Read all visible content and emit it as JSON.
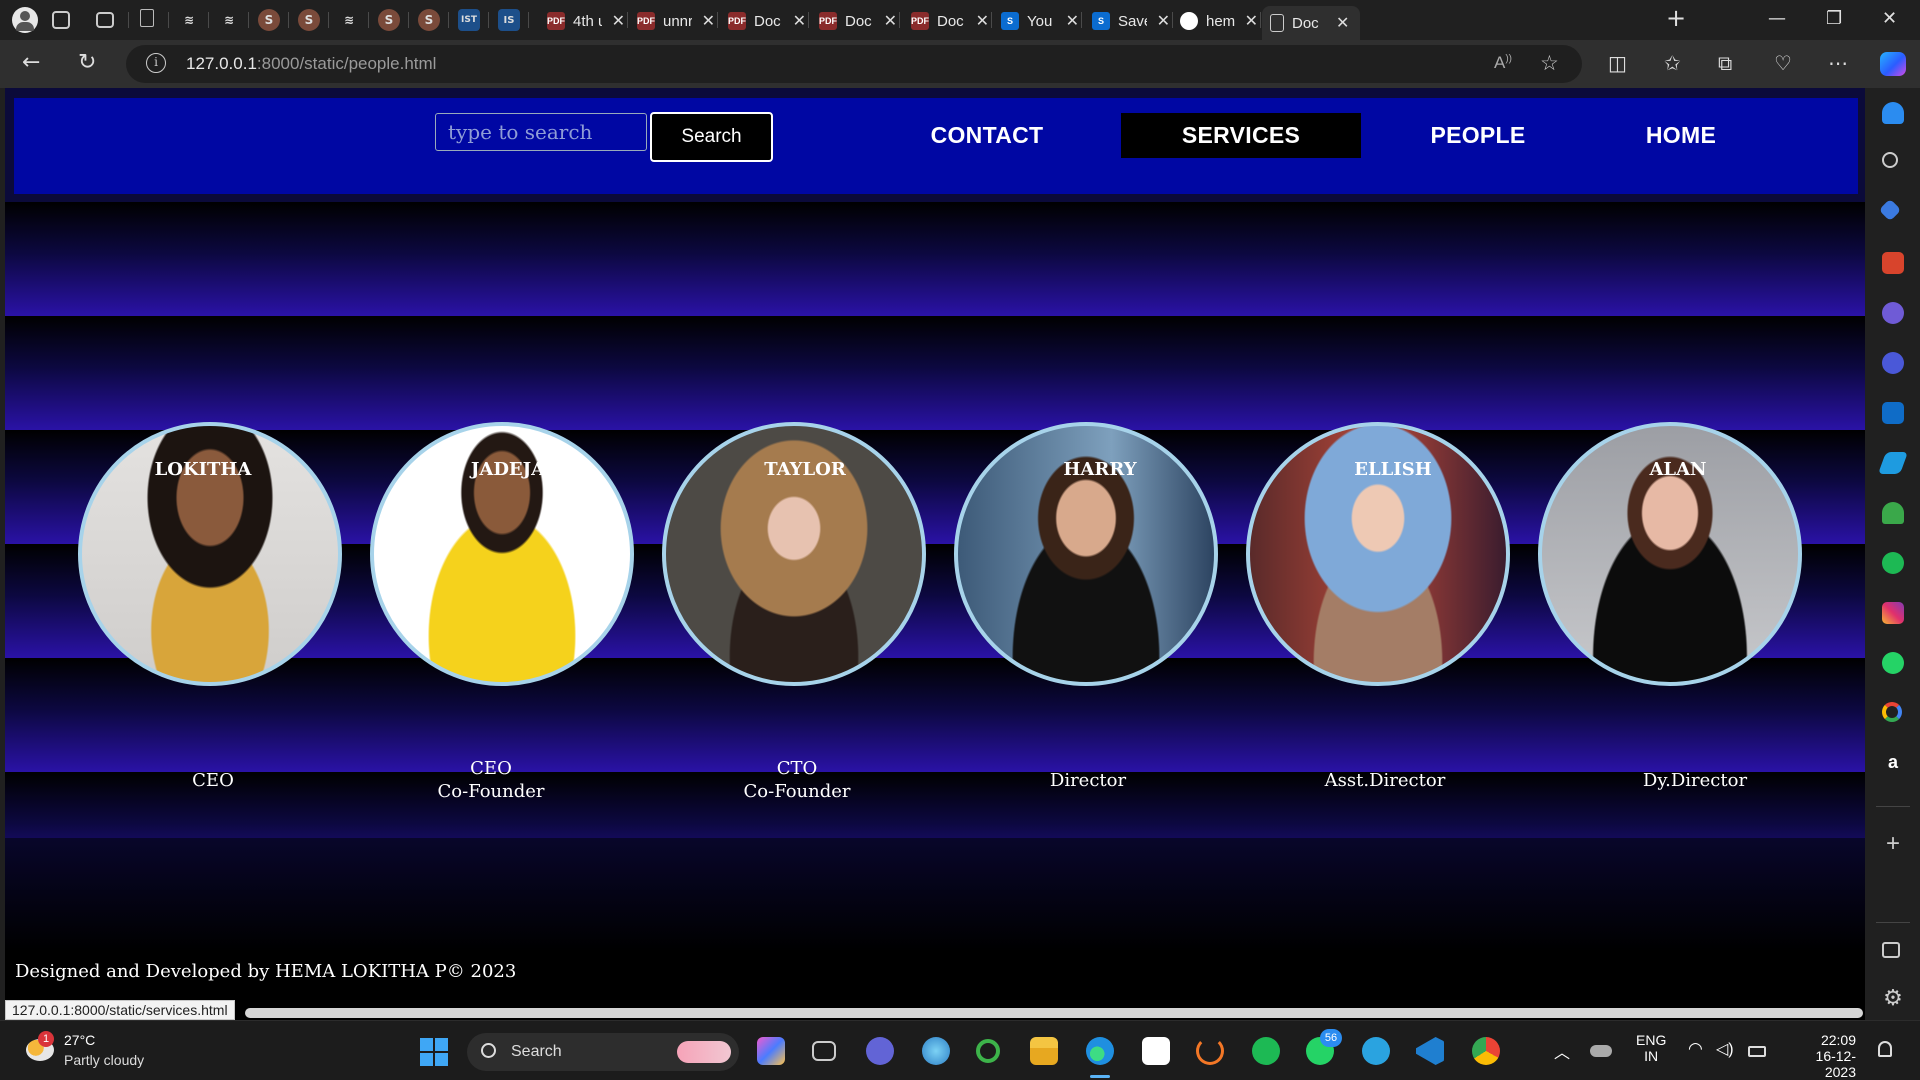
{
  "browser": {
    "tabs": [
      {
        "label": "4th u",
        "fav": "PDF",
        "color": "#8a2b2b"
      },
      {
        "label": "unnr",
        "fav": "PDF",
        "color": "#8a2b2b"
      },
      {
        "label": "Doc",
        "fav": "PDF",
        "color": "#8a2b2b"
      },
      {
        "label": "Doc",
        "fav": "PDF",
        "color": "#8a2b2b"
      },
      {
        "label": "Doc",
        "fav": "PDF",
        "color": "#8a2b2b"
      },
      {
        "label": "You",
        "fav": "S",
        "color": "#0b6cd0"
      },
      {
        "label": "Save",
        "fav": "S",
        "color": "#0b6cd0"
      },
      {
        "label": "hem",
        "fav": "gh",
        "color": "#202020"
      },
      {
        "label": "Doc",
        "fav": "doc",
        "color": "#2f2f2f"
      }
    ],
    "url_host": "127.0.0.1",
    "url_rest": ":8000/static/people.html",
    "status_url": "127.0.0.1:8000/static/services.html",
    "small_tab_icons": [
      "IST",
      "IS"
    ]
  },
  "page": {
    "search_placeholder": "type to search",
    "search_button": "Search",
    "nav": {
      "contact": "CONTACT",
      "services": "SERVICES",
      "people": "PEOPLE",
      "home": "HOME"
    },
    "people": [
      {
        "name": "LOKITHA",
        "role": "CEO",
        "role2": ""
      },
      {
        "name": "JADEJA",
        "role": "CEO",
        "role2": "Co-Founder"
      },
      {
        "name": "TAYLOR",
        "role": "CTO",
        "role2": "Co-Founder"
      },
      {
        "name": "HARRY",
        "role": "Director",
        "role2": ""
      },
      {
        "name": "ELLISH",
        "role": "Asst.Director",
        "role2": ""
      },
      {
        "name": "ALAN",
        "role": "Dy.Director",
        "role2": ""
      }
    ],
    "footer": "Designed and Developed by HEMA LOKITHA P© 2023"
  },
  "taskbar": {
    "weather_temp": "27°C",
    "weather_desc": "Partly cloudy",
    "weather_badge": "1",
    "search_label": "Search",
    "whatsapp_badge": "56",
    "lang": "ENG",
    "region": "IN",
    "time": "22:09",
    "date": "16-12-2023"
  },
  "colors": {
    "navbar": "#0007a3",
    "photo_border": "#a7d3ea",
    "stripe_bottom": "#2a12a6"
  }
}
